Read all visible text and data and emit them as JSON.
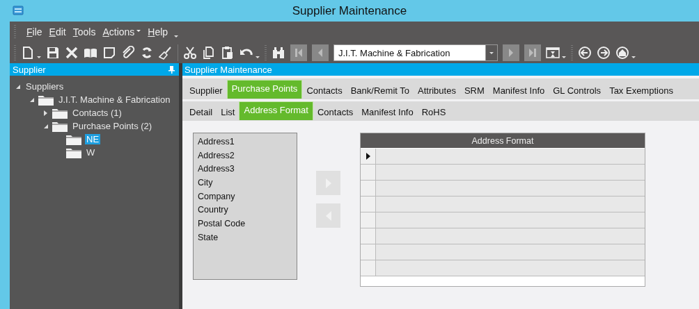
{
  "window": {
    "title": "Supplier Maintenance"
  },
  "menu": [
    {
      "label": "File",
      "dropdown": false
    },
    {
      "label": "Edit",
      "dropdown": false
    },
    {
      "label": "Tools",
      "dropdown": false
    },
    {
      "label": "Actions",
      "dropdown": true
    },
    {
      "label": "Help",
      "dropdown": false
    }
  ],
  "toolbar": {
    "record": {
      "value": "J.I.T. Machine & Fabrication"
    }
  },
  "tree_panel": {
    "title": "Supplier",
    "tree": [
      {
        "label": "Suppliers",
        "expanded": true,
        "selected": false,
        "children": [
          {
            "label": "J.I.T. Machine & Fabrication",
            "expanded": true,
            "selected": false,
            "children": [
              {
                "label": "Contacts (1)",
                "expanded": false,
                "selected": false
              },
              {
                "label": "Purchase Points (2)",
                "expanded": true,
                "selected": false,
                "children": [
                  {
                    "label": "NE",
                    "selected": true
                  },
                  {
                    "label": "W",
                    "selected": false
                  }
                ]
              }
            ]
          }
        ]
      }
    ]
  },
  "main_panel": {
    "title": "Supplier Maintenance",
    "tabs": [
      {
        "label": "Supplier",
        "selected": false
      },
      {
        "label": "Purchase Points",
        "selected": true
      },
      {
        "label": "Contacts",
        "selected": false
      },
      {
        "label": "Bank/Remit To",
        "selected": false
      },
      {
        "label": "Attributes",
        "selected": false
      },
      {
        "label": "SRM",
        "selected": false
      },
      {
        "label": "Manifest Info",
        "selected": false
      },
      {
        "label": "GL Controls",
        "selected": false
      },
      {
        "label": "Tax Exemptions",
        "selected": false
      }
    ],
    "subtabs": [
      {
        "label": "Detail",
        "selected": false
      },
      {
        "label": "List",
        "selected": false
      },
      {
        "label": "Address Format",
        "selected": true
      },
      {
        "label": "Contacts",
        "selected": false
      },
      {
        "label": "Manifest Info",
        "selected": false
      },
      {
        "label": "RoHS",
        "selected": false
      }
    ],
    "available_fields": [
      "Address1",
      "Address2",
      "Address3",
      "City",
      "Company",
      "Country",
      "Postal Code",
      "State"
    ],
    "move_buttons": [
      {
        "kind": "add",
        "disabled": true
      },
      {
        "kind": "remove",
        "disabled": true
      }
    ],
    "grid": {
      "header": "Address Format",
      "rows": [
        {
          "current": true
        },
        {
          "current": false
        },
        {
          "current": false
        },
        {
          "current": false
        },
        {
          "current": false
        },
        {
          "current": false
        },
        {
          "current": false
        },
        {
          "current": false
        }
      ]
    }
  }
}
